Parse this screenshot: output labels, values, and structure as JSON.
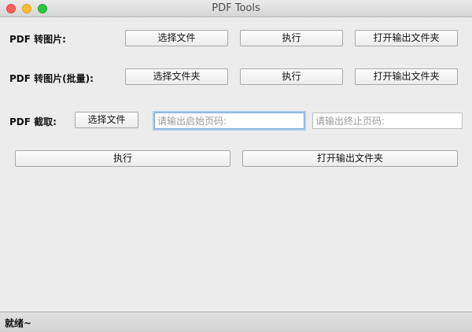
{
  "window": {
    "title": "PDF Tools"
  },
  "rows": [
    {
      "label": "PDF 转图片:",
      "select_label": "选择文件",
      "execute_label": "执行",
      "open_label": "打开输出文件夹"
    },
    {
      "label": "PDF 转图片(批量):",
      "select_label": "选择文件夹",
      "execute_label": "执行",
      "open_label": "打开输出文件夹"
    },
    {
      "label": "PDF 截取:",
      "select_label": "选择文件",
      "start_page_placeholder": "请输出启始页码:",
      "end_page_placeholder": "请输出终止页码:",
      "execute_label": "执行",
      "open_label": "打开输出文件夹"
    }
  ],
  "status": {
    "text": "就绪~"
  },
  "colors": {
    "close": "#fe5f57",
    "minimize": "#febc2e",
    "maximize": "#28c840",
    "focus_ring": "#aecbef"
  }
}
